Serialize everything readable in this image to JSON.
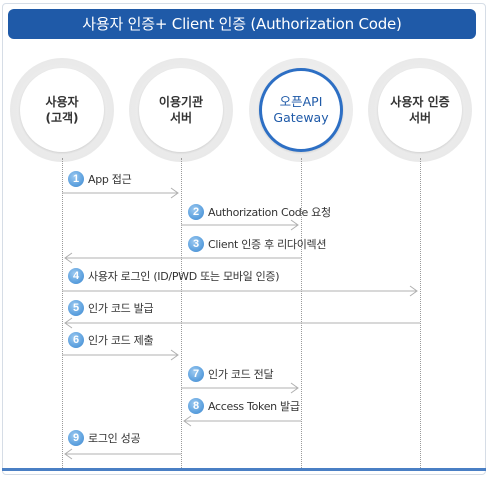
{
  "title": "사용자 인증+ Client 인증 (Authorization Code)",
  "actors": [
    {
      "label": "사용자\n(고객)",
      "highlight": false
    },
    {
      "label": "이용기관\n서버",
      "highlight": false
    },
    {
      "label": "오픈API\nGateway",
      "highlight": true
    },
    {
      "label": "사용자 인증\n서버",
      "highlight": false
    }
  ],
  "steps": [
    {
      "num": "1",
      "text": "App 접근"
    },
    {
      "num": "2",
      "text": "Authorization Code 요청"
    },
    {
      "num": "3",
      "text": "Client 인증 후 리다이렉션"
    },
    {
      "num": "4",
      "text": "사용자 로그인 (ID/PWD 또는 모바일 인증)"
    },
    {
      "num": "5",
      "text": "인가 코드 발급"
    },
    {
      "num": "6",
      "text": "인가 코드 제출"
    },
    {
      "num": "7",
      "text": "인가 코드 전달"
    },
    {
      "num": "8",
      "text": "Access Token 발급"
    },
    {
      "num": "9",
      "text": "로그인 성공"
    }
  ],
  "colors": {
    "title_bg": "#1f5aa8",
    "highlight": "#2d6fc4",
    "step_badge": "#5fa2df",
    "arrow": "#b0b0b0"
  }
}
